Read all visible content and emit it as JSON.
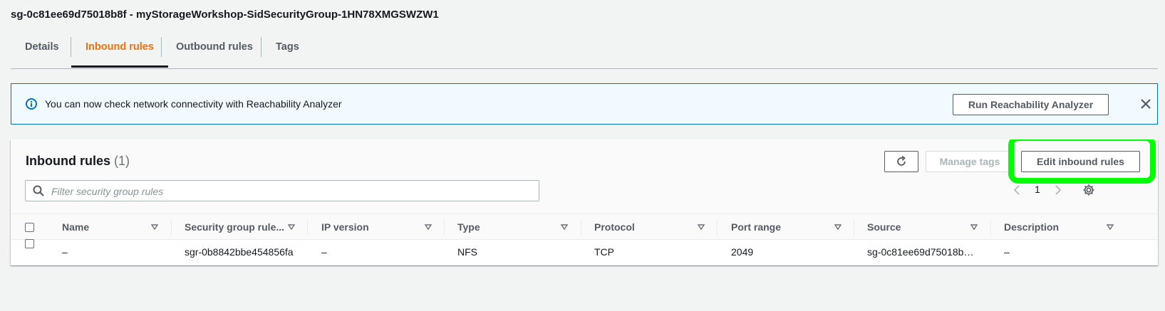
{
  "header": {
    "title": "sg-0c81ee69d75018b8f - myStorageWorkshop-SidSecurityGroup-1HN78XMGSWZW1"
  },
  "tabs": [
    {
      "label": "Details",
      "active": false
    },
    {
      "label": "Inbound rules",
      "active": true
    },
    {
      "label": "Outbound rules",
      "active": false
    },
    {
      "label": "Tags",
      "active": false
    }
  ],
  "banner": {
    "message": "You can now check network connectivity with Reachability Analyzer",
    "button_label": "Run Reachability Analyzer",
    "icon": "info-icon",
    "close_icon": "close-icon"
  },
  "panel": {
    "title": "Inbound rules",
    "count": "(1)",
    "refresh_icon": "refresh-icon",
    "manage_tags_label": "Manage tags",
    "edit_label": "Edit inbound rules",
    "filter_placeholder": "Filter security group rules",
    "page_number": "1",
    "settings_icon": "gear-icon"
  },
  "table": {
    "columns": [
      "Name",
      "Security group rule...",
      "IP version",
      "Type",
      "Protocol",
      "Port range",
      "Source",
      "Description"
    ],
    "rows": [
      {
        "name": "–",
        "rule_id": "sgr-0b8842bbe454856fa",
        "ip_version": "–",
        "type": "NFS",
        "protocol": "TCP",
        "port_range": "2049",
        "source": "sg-0c81ee69d75018b…",
        "description": "–"
      }
    ]
  },
  "colors": {
    "accent": "#ec7211",
    "info_border": "#0073bb",
    "highlight": "#00ff00"
  }
}
